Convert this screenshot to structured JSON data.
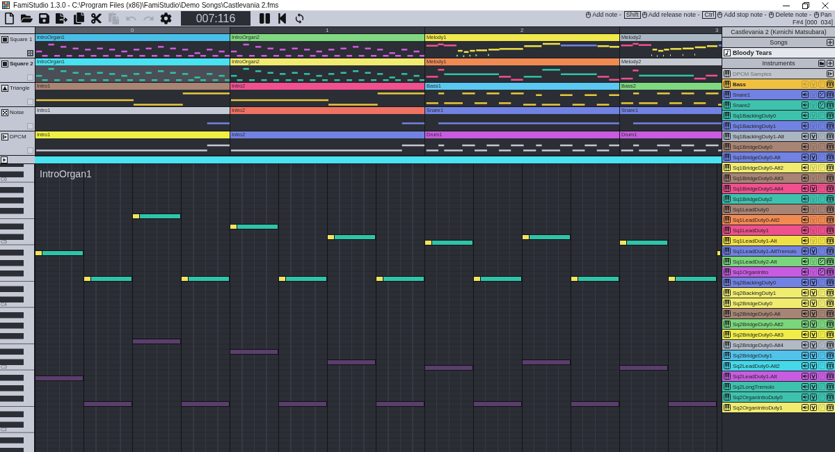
{
  "window": {
    "title": "FamiStudio 1.3.0 - C:\\Program Files (x86)\\FamiStudio\\Demo Songs\\Castlevania 2.fms"
  },
  "toolbar": {
    "file_buttons": [
      {
        "kind": "new",
        "disabled": false
      },
      {
        "kind": "open",
        "disabled": false
      },
      {
        "kind": "save",
        "disabled": false
      },
      {
        "kind": "export",
        "disabled": false
      },
      {
        "kind": "copy",
        "disabled": false
      },
      {
        "kind": "cut",
        "disabled": false
      },
      {
        "kind": "paste",
        "disabled": true
      },
      {
        "kind": "undo",
        "disabled": true
      },
      {
        "kind": "redo",
        "disabled": true
      },
      {
        "kind": "config",
        "disabled": false
      }
    ],
    "timecode": "007:116",
    "transport": [
      {
        "kind": "pause"
      },
      {
        "kind": "rewind"
      },
      {
        "kind": "loop"
      }
    ],
    "hints": [
      {
        "text": "Add note -"
      },
      {
        "key": "Shift",
        "text": "Add release note -"
      },
      {
        "key": "Ctrl",
        "text": "Add stop note -"
      },
      {
        "text": "Delete note -"
      },
      {
        "text": "Pan"
      }
    ],
    "note_info": "F#4 [000  034]"
  },
  "sequencer": {
    "columns": [
      {
        "label": "0",
        "selected": true
      },
      {
        "label": "1",
        "selected": false
      },
      {
        "label": "2",
        "selected": false
      },
      {
        "label": "3",
        "selected": false
      }
    ],
    "tracks": [
      {
        "name": "Square 1",
        "kind": "square",
        "selected": false,
        "ghost": true,
        "patterns": [
          {
            "name": "IntroOrgan1",
            "color": "#48bfe8",
            "selected": false
          },
          {
            "name": "IntroOrgan2",
            "color": "#80d880",
            "selected": false
          },
          {
            "name": "Melody1",
            "color": "#f0e84c",
            "selected": false
          },
          {
            "name": "Melody2",
            "color": "#a9b7c3",
            "selected": false
          }
        ]
      },
      {
        "name": "Square 2",
        "kind": "square",
        "selected": true,
        "ghost": false,
        "patterns": [
          {
            "name": "IntroOrgan1",
            "color": "#48e2f0",
            "selected": true
          },
          {
            "name": "IntroOrgan2",
            "color": "#f0ec70",
            "selected": false
          },
          {
            "name": "Melody1",
            "color": "#f08a52",
            "selected": false
          },
          {
            "name": "Melody2",
            "color": "#c4c8d0",
            "selected": false
          }
        ]
      },
      {
        "name": "Triangle",
        "kind": "triangle",
        "selected": false,
        "ghost": false,
        "patterns": [
          {
            "name": "Intro1",
            "color": "#a88474",
            "selected": false
          },
          {
            "name": "Intro2",
            "color": "#f0508e",
            "selected": false
          },
          {
            "name": "Bass1",
            "color": "#5ac8f0",
            "selected": false
          },
          {
            "name": "Bass2",
            "color": "#80d880",
            "selected": false
          }
        ]
      },
      {
        "name": "Noise",
        "kind": "noise",
        "selected": false,
        "ghost": false,
        "patterns": [
          {
            "name": "Intro1",
            "color": "#c6cad6",
            "selected": false
          },
          {
            "name": "Intro2",
            "color": "#f07262",
            "selected": false
          },
          {
            "name": "Snare1",
            "color": "#7282e2",
            "selected": false
          },
          {
            "name": "Snare1",
            "color": "#7282e2",
            "selected": false
          }
        ]
      },
      {
        "name": "DPCM",
        "kind": "dpcm",
        "selected": false,
        "ghost": false,
        "patterns": [
          {
            "name": "Intro1",
            "color": "#f0f044",
            "selected": false
          },
          {
            "name": "Intro2",
            "color": "#7282e2",
            "selected": false
          },
          {
            "name": "Drum1",
            "color": "#c85ce0",
            "selected": false
          },
          {
            "name": "Drum1",
            "color": "#c85ce0",
            "selected": false
          }
        ]
      }
    ]
  },
  "piano_roll": {
    "pattern_name": "IntroOrgan1",
    "octave_labels": [
      "C6",
      "C5",
      "C4",
      "C3",
      "C2"
    ]
  },
  "project": {
    "title": "Castlevania 2 (Kenichi Matsubara)",
    "songs_header": "Songs",
    "songs": [
      {
        "name": "Bloody Tears",
        "selected": true
      }
    ],
    "instruments_header": "Instruments",
    "instruments": [
      {
        "name": "DPCM Samples",
        "kind": "dpcm",
        "selected": false
      },
      {
        "name": "Bass",
        "kind": "instrument",
        "color": "#f0c040",
        "selected": true,
        "volume": false,
        "pitch": false,
        "arpeggio": false,
        "duty": true
      },
      {
        "name": "Snare1",
        "kind": "instrument",
        "color": "#7282e2",
        "selected": false,
        "volume": true,
        "pitch": false,
        "arpeggio": true,
        "duty": true
      },
      {
        "name": "Snare2",
        "kind": "instrument",
        "color": "#3ec2ae",
        "selected": false,
        "volume": true,
        "pitch": false,
        "arpeggio": true,
        "duty": true
      },
      {
        "name": "Sq1BackingDuty0",
        "kind": "instrument",
        "color": "#3ec2ae",
        "selected": false,
        "volume": true,
        "pitch": false,
        "arpeggio": false,
        "duty": true
      },
      {
        "name": "Sq1BackingDuty1",
        "kind": "instrument",
        "color": "#7282e2",
        "selected": false,
        "volume": true,
        "pitch": false,
        "arpeggio": false,
        "duty": true
      },
      {
        "name": "Sq1BackingDuty1-Alt",
        "kind": "instrument",
        "color": "#a9b5c1",
        "selected": false,
        "volume": true,
        "pitch": true,
        "arpeggio": false,
        "duty": true
      },
      {
        "name": "Sq1BridgeDuty0",
        "kind": "instrument",
        "color": "#a88474",
        "selected": false,
        "volume": true,
        "pitch": false,
        "arpeggio": false,
        "duty": true
      },
      {
        "name": "Sq1BridgeDuty0-Alt",
        "kind": "instrument",
        "color": "#7282e2",
        "selected": false,
        "volume": true,
        "pitch": true,
        "arpeggio": false,
        "duty": true
      },
      {
        "name": "Sq1BridgeDuty0-Alt2",
        "kind": "instrument",
        "color": "#f0ec70",
        "selected": false,
        "volume": true,
        "pitch": false,
        "arpeggio": false,
        "duty": true
      },
      {
        "name": "Sq1BridgeDuty0-Alt3",
        "kind": "instrument",
        "color": "#a88474",
        "selected": false,
        "volume": true,
        "pitch": false,
        "arpeggio": false,
        "duty": true
      },
      {
        "name": "Sq1BridgeDuty0-Alt4",
        "kind": "instrument",
        "color": "#f0508e",
        "selected": false,
        "volume": true,
        "pitch": true,
        "arpeggio": false,
        "duty": true
      },
      {
        "name": "Sq1BridgeDuty2",
        "kind": "instrument",
        "color": "#3ec2ae",
        "selected": false,
        "volume": true,
        "pitch": false,
        "arpeggio": false,
        "duty": true
      },
      {
        "name": "Sq1LeadDuty0",
        "kind": "instrument",
        "color": "#a88474",
        "selected": false,
        "volume": true,
        "pitch": false,
        "arpeggio": false,
        "duty": true
      },
      {
        "name": "Sq1LeadDuty0-Alt2",
        "kind": "instrument",
        "color": "#f08a52",
        "selected": false,
        "volume": true,
        "pitch": false,
        "arpeggio": false,
        "duty": true
      },
      {
        "name": "Sq1LeadDuty1",
        "kind": "instrument",
        "color": "#f0508e",
        "selected": false,
        "volume": true,
        "pitch": false,
        "arpeggio": false,
        "duty": true
      },
      {
        "name": "Sq1LeadDuty1-Alt",
        "kind": "instrument",
        "color": "#f0e048",
        "selected": false,
        "volume": true,
        "pitch": false,
        "arpeggio": false,
        "duty": true
      },
      {
        "name": "Sq1LeadDuty1-AltTremolo",
        "kind": "instrument",
        "color": "#7282e2",
        "selected": false,
        "volume": true,
        "pitch": true,
        "arpeggio": false,
        "duty": true
      },
      {
        "name": "Sq1LeadDuty2-Alt",
        "kind": "instrument",
        "color": "#7ad67c",
        "selected": false,
        "volume": true,
        "pitch": false,
        "arpeggio": true,
        "duty": true
      },
      {
        "name": "Sq1OrganIntro",
        "kind": "instrument",
        "color": "#c85ce0",
        "selected": false,
        "volume": true,
        "pitch": false,
        "arpeggio": true,
        "duty": true
      },
      {
        "name": "Sq2BackingDuty0",
        "kind": "instrument",
        "color": "#7282e2",
        "selected": false,
        "volume": true,
        "pitch": true,
        "arpeggio": false,
        "duty": true
      },
      {
        "name": "Sq2BackingDuty1",
        "kind": "instrument",
        "color": "#f0ec70",
        "selected": false,
        "volume": true,
        "pitch": true,
        "arpeggio": false,
        "duty": true
      },
      {
        "name": "Sq2BridgeDuty0",
        "kind": "instrument",
        "color": "#f0ec70",
        "selected": false,
        "volume": true,
        "pitch": true,
        "arpeggio": false,
        "duty": true
      },
      {
        "name": "Sq2BridgeDuty0-Alt",
        "kind": "instrument",
        "color": "#a88474",
        "selected": false,
        "volume": true,
        "pitch": true,
        "arpeggio": false,
        "duty": true
      },
      {
        "name": "Sq2BridgeDuty0-Alt2",
        "kind": "instrument",
        "color": "#7ad67c",
        "selected": false,
        "volume": true,
        "pitch": true,
        "arpeggio": false,
        "duty": true
      },
      {
        "name": "Sq2BridgeDuty0-Alt3",
        "kind": "instrument",
        "color": "#f0ec48",
        "selected": false,
        "volume": true,
        "pitch": true,
        "arpeggio": false,
        "duty": true
      },
      {
        "name": "Sq2BridgeDuty0-Alt4",
        "kind": "instrument",
        "color": "#b1b9c5",
        "selected": false,
        "volume": true,
        "pitch": true,
        "arpeggio": false,
        "duty": true
      },
      {
        "name": "Sq2BridgeDuty1",
        "kind": "instrument",
        "color": "#52c2ea",
        "selected": false,
        "volume": true,
        "pitch": true,
        "arpeggio": false,
        "duty": true
      },
      {
        "name": "Sq2LeadDuty0-Alt2",
        "kind": "instrument",
        "color": "#44d8e8",
        "selected": false,
        "volume": true,
        "pitch": true,
        "arpeggio": false,
        "duty": true
      },
      {
        "name": "Sq2LeadDuty1-Alt",
        "kind": "instrument",
        "color": "#c85ce0",
        "selected": false,
        "volume": true,
        "pitch": true,
        "arpeggio": false,
        "duty": true
      },
      {
        "name": "Sq2LongTremolo",
        "kind": "instrument",
        "color": "#3ec2ae",
        "selected": false,
        "volume": true,
        "pitch": true,
        "arpeggio": false,
        "duty": true
      },
      {
        "name": "Sq2OrganIntroDuty0",
        "kind": "instrument",
        "color": "#3ec2ae",
        "selected": false,
        "volume": true,
        "pitch": true,
        "arpeggio": false,
        "duty": true
      },
      {
        "name": "Sq2OrganIntroDuty1",
        "kind": "instrument",
        "color": "#f0ec70",
        "selected": false,
        "volume": true,
        "pitch": true,
        "arpeggio": false,
        "duty": true
      }
    ]
  }
}
